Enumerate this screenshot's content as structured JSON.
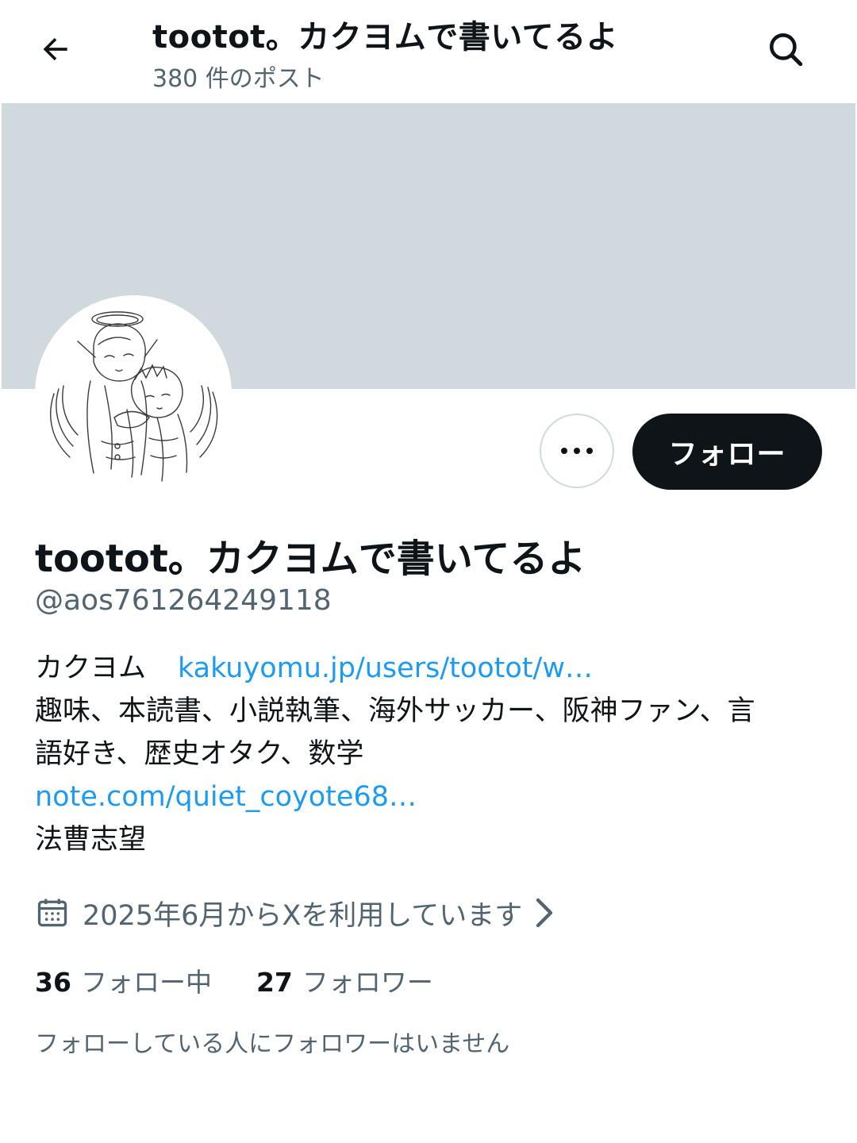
{
  "header": {
    "title": "tootot。カクヨムで書いてるよ",
    "post_count": "380 件のポスト",
    "back_icon": "arrow-left-icon",
    "search_icon": "search-icon"
  },
  "colors": {
    "banner": "#cfd9de",
    "link": "#1d9bf0",
    "secondary_text": "#536471",
    "primary_text": "#0f1419",
    "follow_button_bg": "#0f1419"
  },
  "actions": {
    "more_icon": "more-horizontal-icon",
    "follow_label": "フォロー"
  },
  "profile": {
    "display_name": "tootot。カクヨムで書いてるよ",
    "handle": "@aos761264249118",
    "bio": {
      "line1_prefix": "カクヨム",
      "line1_link": "kakuyomu.jp/users/tootot/w…",
      "line2": "趣味、本読書、小説執筆、海外サッカー、阪神ファン、言",
      "line3": "語好き、歴史オタク、数学",
      "line4_link": "note.com/quiet_coyote68…",
      "line5": "法曹志望"
    },
    "joined": "2025年6月からXを利用しています",
    "joined_icon": "calendar-icon",
    "chevron_icon": "chevron-right-icon",
    "following_count": "36",
    "following_label": "フォロー中",
    "followers_count": "27",
    "followers_label": "フォロワー",
    "followers_you_know": "フォローしている人にフォロワーはいません"
  }
}
